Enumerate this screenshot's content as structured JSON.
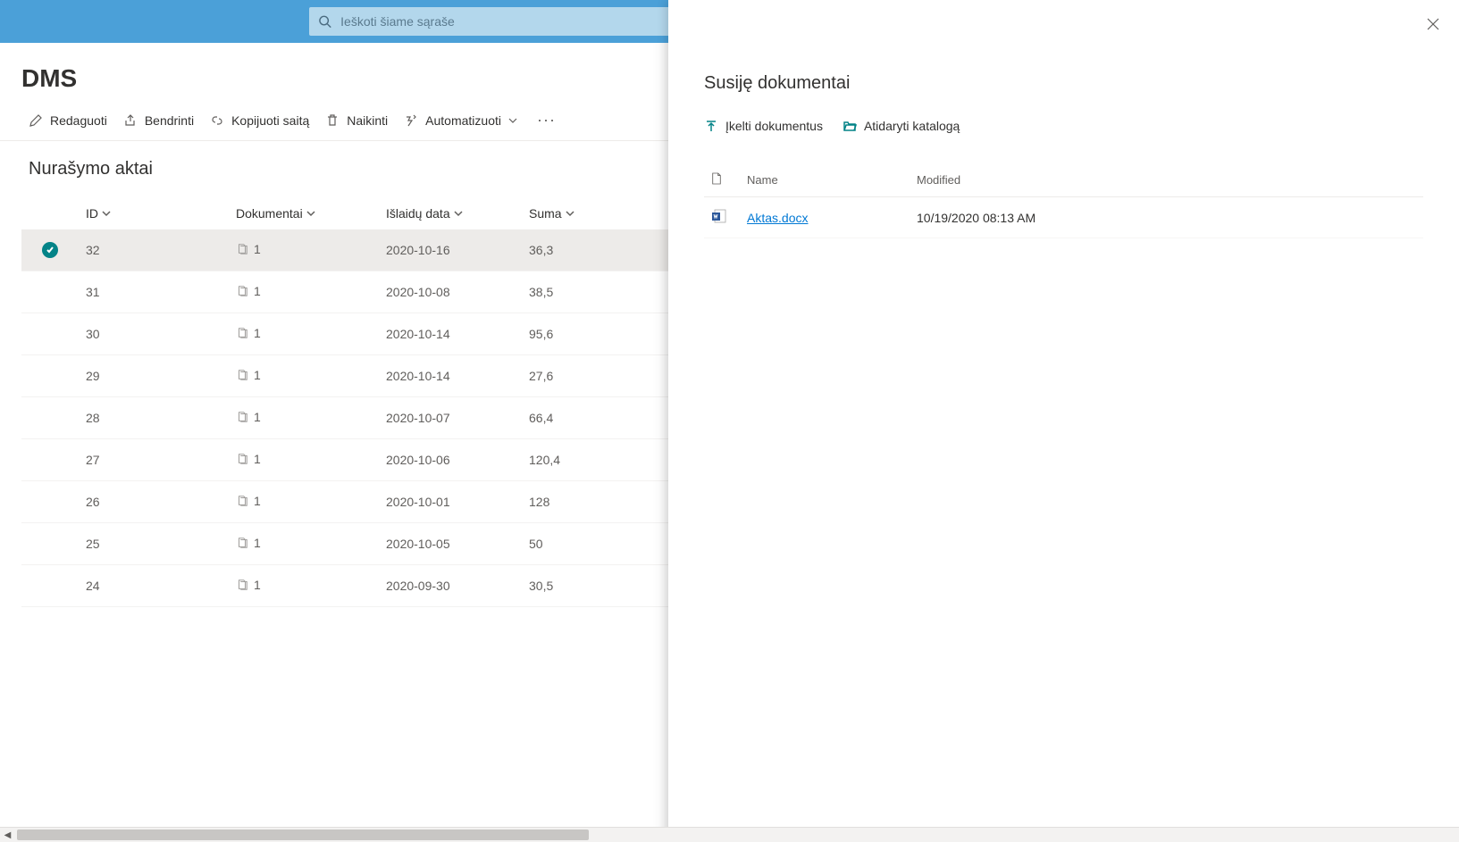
{
  "search": {
    "placeholder": "Ieškoti šiame sąraše"
  },
  "site": {
    "title": "DMS"
  },
  "commands": {
    "edit": "Redaguoti",
    "share": "Bendrinti",
    "copy_link": "Kopijuoti saitą",
    "delete": "Naikinti",
    "automate": "Automatizuoti"
  },
  "list": {
    "title": "Nurašymo aktai",
    "columns": {
      "id": "ID",
      "documents": "Dokumentai",
      "date": "Išlaidų data",
      "sum": "Suma"
    },
    "rows": [
      {
        "id": "32",
        "doc_count": "1",
        "date": "2020-10-16",
        "sum": "36,3",
        "selected": true
      },
      {
        "id": "31",
        "doc_count": "1",
        "date": "2020-10-08",
        "sum": "38,5",
        "selected": false
      },
      {
        "id": "30",
        "doc_count": "1",
        "date": "2020-10-14",
        "sum": "95,6",
        "selected": false
      },
      {
        "id": "29",
        "doc_count": "1",
        "date": "2020-10-14",
        "sum": "27,6",
        "selected": false
      },
      {
        "id": "28",
        "doc_count": "1",
        "date": "2020-10-07",
        "sum": "66,4",
        "selected": false
      },
      {
        "id": "27",
        "doc_count": "1",
        "date": "2020-10-06",
        "sum": "120,4",
        "selected": false
      },
      {
        "id": "26",
        "doc_count": "1",
        "date": "2020-10-01",
        "sum": "128",
        "selected": false
      },
      {
        "id": "25",
        "doc_count": "1",
        "date": "2020-10-05",
        "sum": "50",
        "selected": false
      },
      {
        "id": "24",
        "doc_count": "1",
        "date": "2020-09-30",
        "sum": "30,5",
        "selected": false
      }
    ]
  },
  "panel": {
    "title": "Susiję dokumentai",
    "upload": "Įkelti dokumentus",
    "open_folder": "Atidaryti katalogą",
    "columns": {
      "name": "Name",
      "modified": "Modified"
    },
    "files": [
      {
        "name": "Aktas.docx",
        "modified": "10/19/2020 08:13 AM"
      }
    ]
  }
}
